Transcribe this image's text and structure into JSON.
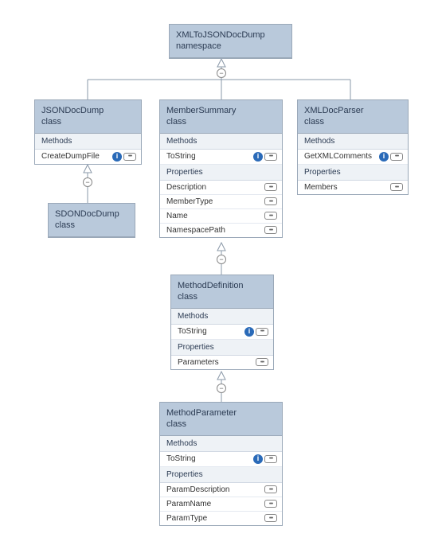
{
  "schema": "uml-class-diagram",
  "namespace": {
    "title_line1": "XMLToJSONDocDump",
    "title_line2": "namespace"
  },
  "labels": {
    "methods": "Methods",
    "properties": "Properties"
  },
  "markers": {
    "info": "i",
    "prop_glyph": "•••",
    "collapse": "−"
  },
  "classes": {
    "jsonDocDump": {
      "title_line1": "JSONDocDump",
      "title_line2": "class",
      "methods": [
        {
          "name": "CreateDumpFile",
          "has_info": true,
          "has_prop": true
        }
      ]
    },
    "sdonDocDump": {
      "title_line1": "SDONDocDump",
      "title_line2": "class"
    },
    "memberSummary": {
      "title_line1": "MemberSummary",
      "title_line2": "class",
      "methods": [
        {
          "name": "ToString",
          "has_info": true,
          "has_prop": true
        }
      ],
      "properties": [
        {
          "name": "Description",
          "has_prop": true
        },
        {
          "name": "MemberType",
          "has_prop": true
        },
        {
          "name": "Name",
          "has_prop": true
        },
        {
          "name": "NamespacePath",
          "has_prop": true
        }
      ]
    },
    "methodDefinition": {
      "title_line1": "MethodDefinition",
      "title_line2": "class",
      "methods": [
        {
          "name": "ToString",
          "has_info": true,
          "has_prop": true
        }
      ],
      "properties": [
        {
          "name": "Parameters",
          "has_prop": true
        }
      ]
    },
    "methodParameter": {
      "title_line1": "MethodParameter",
      "title_line2": "class",
      "methods": [
        {
          "name": "ToString",
          "has_info": true,
          "has_prop": true
        }
      ],
      "properties": [
        {
          "name": "ParamDescription",
          "has_prop": true
        },
        {
          "name": "ParamName",
          "has_prop": true
        },
        {
          "name": "ParamType",
          "has_prop": true
        }
      ]
    },
    "xmlDocParser": {
      "title_line1": "XMLDocParser",
      "title_line2": "class",
      "methods": [
        {
          "name": "GetXMLComments",
          "has_info": true,
          "has_prop": true
        }
      ],
      "properties": [
        {
          "name": "Members",
          "has_prop": true
        }
      ]
    }
  }
}
